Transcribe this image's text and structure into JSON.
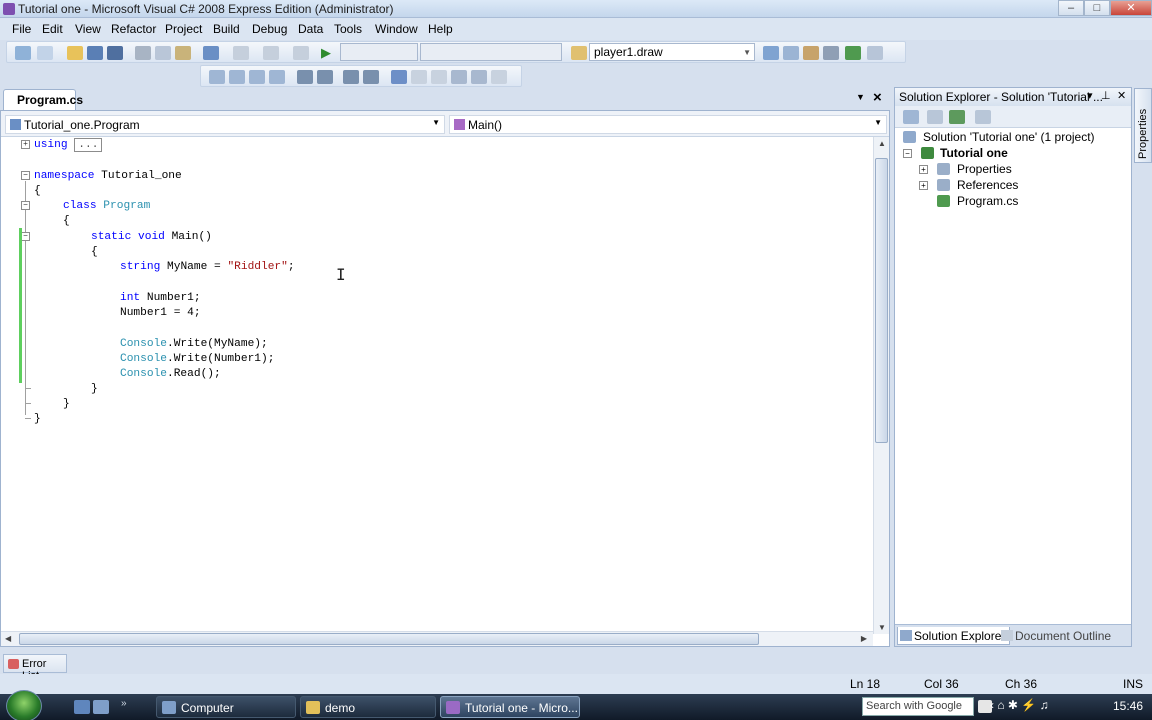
{
  "window": {
    "title": "Tutorial one - Microsoft Visual C# 2008 Express Edition (Administrator)",
    "controls": {
      "minimize": "–",
      "maximize": "□",
      "close": "✕"
    }
  },
  "menu": [
    "File",
    "Edit",
    "View",
    "Refactor",
    "Project",
    "Build",
    "Debug",
    "Data",
    "Tools",
    "Window",
    "Help"
  ],
  "toolbar": {
    "config_combo": "",
    "platform_combo": "",
    "find_combo": "player1.draw"
  },
  "document": {
    "tab_label": "Program.cs",
    "type_combo": "Tutorial_one.Program",
    "member_combo": "Main()"
  },
  "code": {
    "using_keyword": "using",
    "using_collapsed": "...",
    "lines": [
      "namespace Tutorial_one",
      "{",
      "class Program",
      "{",
      "static void Main()",
      "{",
      "string MyName = \"Riddler\";",
      "int Number1;",
      "Number1 = 4;",
      "Console.Write(MyName);",
      "Console.Write(Number1);",
      "Console.Read();",
      "}",
      "}",
      "}"
    ]
  },
  "solution_explorer": {
    "header": "Solution Explorer - Solution 'Tutorial ...",
    "solution": "Solution 'Tutorial one' (1 project)",
    "project": "Tutorial one",
    "items": [
      "Properties",
      "References",
      "Program.cs"
    ],
    "tabs": [
      "Solution Explorer",
      "Document Outline"
    ]
  },
  "side_tab": "Properties",
  "error_list_tab": "Error List",
  "status": {
    "line": "Ln 18",
    "col": "Col 36",
    "ch": "Ch 36",
    "mode": "INS"
  },
  "taskbar": {
    "tasks": [
      "Computer",
      "demo",
      "Tutorial one - Micro..."
    ],
    "search_placeholder": "Search with Google",
    "clock": "15:46"
  },
  "colors": {
    "keyword": "#0000ff",
    "type": "#2b91af",
    "string": "#a31515",
    "change_marker": "#5ecf5e"
  }
}
